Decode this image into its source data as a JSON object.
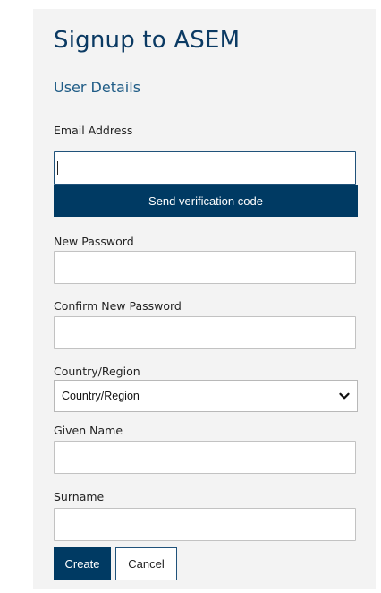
{
  "header": {
    "title": "Signup to ASEM",
    "subtitle": "User Details"
  },
  "form": {
    "email": {
      "label": "Email Address",
      "value": "",
      "focused": true
    },
    "send_code_label": "Send verification code",
    "new_password": {
      "label": "New Password",
      "value": ""
    },
    "confirm_password": {
      "label": "Confirm New Password",
      "value": ""
    },
    "country": {
      "label": "Country/Region",
      "selected": "Country/Region"
    },
    "given_name": {
      "label": "Given Name",
      "value": ""
    },
    "surname": {
      "label": "Surname",
      "value": ""
    }
  },
  "actions": {
    "create_label": "Create",
    "cancel_label": "Cancel"
  },
  "colors": {
    "primary": "#003a63",
    "panel_background": "#f3f3f3",
    "title": "#0b3a63"
  },
  "icons": {
    "select_arrow": "chevron-down-icon"
  }
}
